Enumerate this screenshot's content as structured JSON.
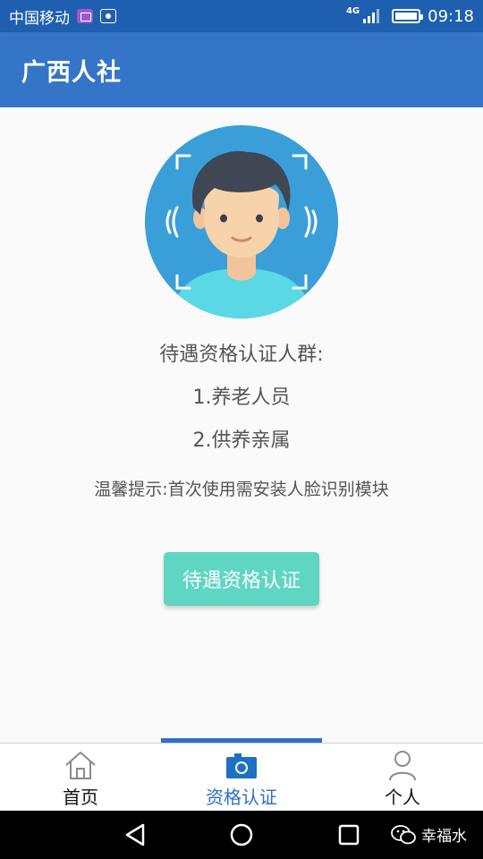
{
  "status_bar": {
    "carrier": "中国移动",
    "network": "4G",
    "time": "09:18",
    "icons": [
      "gallery-icon",
      "paw-icon",
      "signal-icon",
      "battery-icon"
    ]
  },
  "app_bar": {
    "title": "广西人社"
  },
  "main": {
    "avatar_icon": "face-recognition-avatar-icon",
    "eligible_heading": "待遇资格认证人群:",
    "eligible_items": [
      "1.养老人员",
      "2.供养亲属"
    ],
    "tip": "温馨提示:首次使用需安装人脸识别模块",
    "action_label": "待遇资格认证"
  },
  "bottom_nav": {
    "items": [
      {
        "label": "首页",
        "icon": "home-icon",
        "active": false
      },
      {
        "label": "资格认证",
        "icon": "camera-icon",
        "active": true
      },
      {
        "label": "个人",
        "icon": "person-icon",
        "active": false
      }
    ]
  },
  "system_nav": {
    "watermark": "幸福水",
    "icons": [
      "back-icon",
      "home-circle-icon",
      "recents-icon",
      "wechat-icon"
    ]
  },
  "colors": {
    "status_bar": "#1e5fb0",
    "app_bar": "#3575c8",
    "accent_button": "#5fd6c1",
    "active_tab": "#2f6fc4",
    "avatar_bg": "#3a9fd8"
  }
}
